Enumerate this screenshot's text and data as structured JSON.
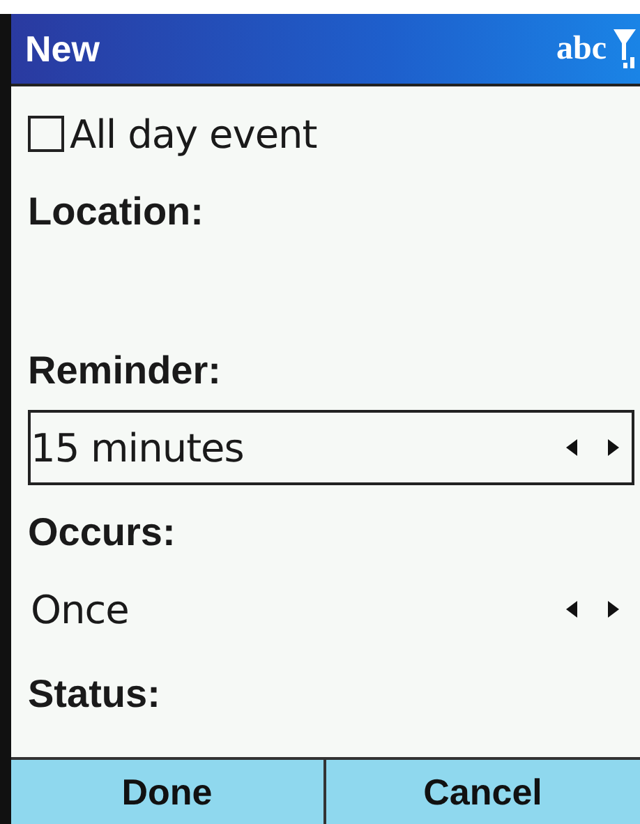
{
  "title_bar": {
    "title": "New",
    "input_mode": "abc"
  },
  "all_day": {
    "label": "All day event",
    "checked": false
  },
  "fields": [
    {
      "kind": "text",
      "label": "Location:"
    },
    {
      "kind": "picker",
      "label": "Reminder:",
      "value": "15 minutes",
      "selected": true
    },
    {
      "kind": "picker",
      "label": "Occurs:",
      "value": "Once",
      "selected": false
    },
    {
      "kind": "label",
      "label": "Status:"
    }
  ],
  "soft_keys": [
    "Done",
    "Cancel"
  ]
}
